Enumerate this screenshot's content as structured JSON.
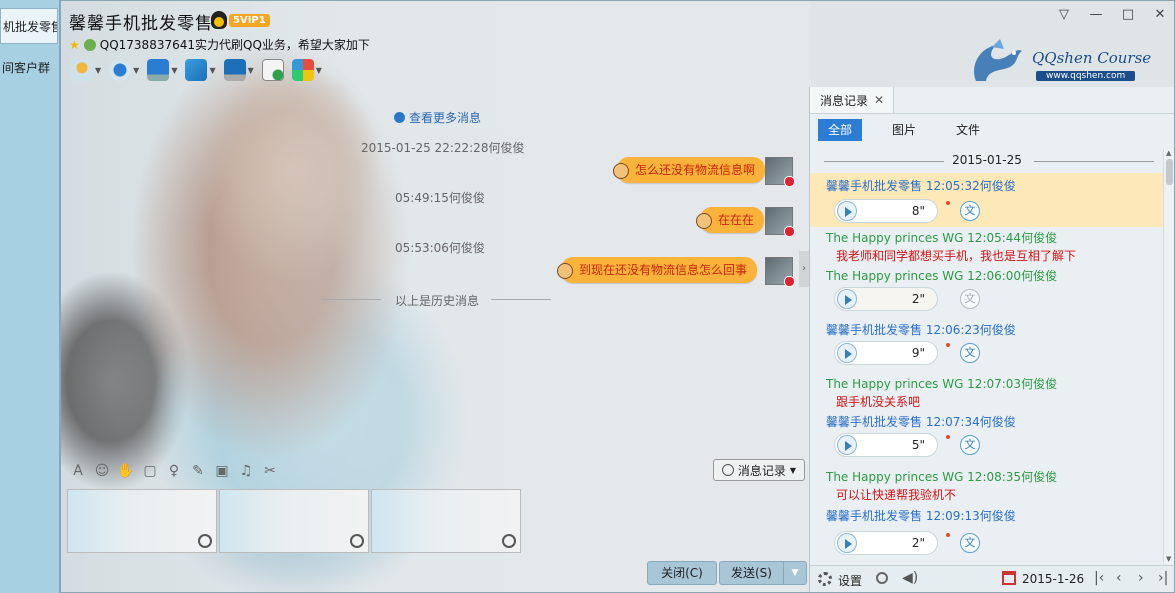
{
  "left_strip": {
    "items": [
      "机批发零售",
      "间客户群"
    ]
  },
  "window": {
    "title": "馨馨手机批发零售",
    "vip": "5VIP1",
    "signature": "QQ1738837641实力代刷QQ业务，希望大家加下",
    "controls": {
      "menu": "▽",
      "minimize": "—",
      "maximize": "□",
      "close": "✕"
    },
    "brand": {
      "name": "QQshen Course",
      "url": "www.qqshen.com"
    },
    "toolbar_icons": [
      "microphone-icon",
      "camera-icon",
      "screen-share-icon",
      "file-transfer-icon",
      "remote-desktop-icon",
      "add-chat-icon",
      "apps-icon"
    ]
  },
  "chat": {
    "more_messages": "查看更多消息",
    "messages": [
      {
        "time": "2015-01-25 22:22:28何俊俊",
        "text": "怎么还没有物流信息啊"
      },
      {
        "time": "05:49:15何俊俊",
        "text": "在在在"
      },
      {
        "time": "05:53:06何俊俊",
        "text": "到现在还没有物流信息怎么回事"
      }
    ],
    "history_divider": "以上是历史消息",
    "history_button": "消息记录",
    "close_button": "关闭(C)",
    "send_button": "发送(S)"
  },
  "panel": {
    "tab": "消息记录",
    "filters": [
      "全部",
      "图片",
      "文件"
    ],
    "active_filter": "全部",
    "date": "2015-01-25",
    "records": [
      {
        "who": "馨馨手机批发零售 12:05:32何俊俊",
        "voice": "8\"",
        "text": ""
      },
      {
        "who": "The Happy princes  WG 12:05:44何俊俊",
        "voice": "",
        "text": "我老师和同学都想买手机，我也是互相了解下"
      },
      {
        "who": "The Happy princes  WG 12:06:00何俊俊",
        "voice": "2\"",
        "text": ""
      },
      {
        "who": "馨馨手机批发零售 12:06:23何俊俊",
        "voice": "9\"",
        "text": ""
      },
      {
        "who": "The Happy princes  WG 12:07:03何俊俊",
        "voice": "",
        "text": "跟手机没关系吧"
      },
      {
        "who": "馨馨手机批发零售 12:07:34何俊俊",
        "voice": "5\"",
        "text": ""
      },
      {
        "who": "The Happy princes  WG 12:08:35何俊俊",
        "voice": "",
        "text": "可以让快递帮我验机不"
      },
      {
        "who": "馨馨手机批发零售 12:09:13何俊俊",
        "voice": "2\"",
        "text": ""
      }
    ],
    "translate_glyph": "文",
    "bottom": {
      "settings": "设置",
      "date": "2015-1-26"
    },
    "colors": {
      "self": "#2a6fc9",
      "other": "#2e9a45",
      "text": "#d01414",
      "highlight": "#fde9b8"
    }
  }
}
